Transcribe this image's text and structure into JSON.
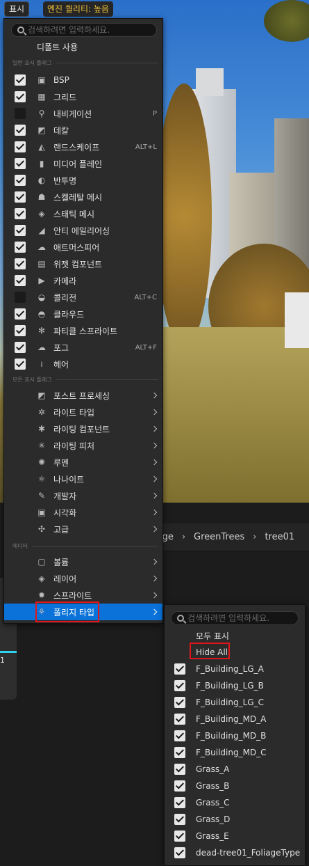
{
  "toolbar": {
    "show_label": "표시",
    "quality_label": "엔진 퀄리티: 높음"
  },
  "breadcrumb": [
    "lage",
    "GreenTrees",
    "tree01"
  ],
  "thumb_label": "1",
  "menu": {
    "search_placeholder": "검색하려면 입력하세요.",
    "default_label": "디폴트 사용",
    "section_common": "일반 표시 플래그",
    "section_all": "모든 표시 플래그",
    "section_editor": "에디터",
    "common_flags": [
      {
        "label": "BSP",
        "checked": true,
        "icon": "cube-icon",
        "shortcut": ""
      },
      {
        "label": "그리드",
        "checked": true,
        "icon": "grid-icon",
        "shortcut": ""
      },
      {
        "label": "내비게이션",
        "checked": false,
        "icon": "map-pin-icon",
        "shortcut": "P"
      },
      {
        "label": "데칼",
        "checked": true,
        "icon": "decal-icon",
        "shortcut": ""
      },
      {
        "label": "랜드스케이프",
        "checked": true,
        "icon": "landscape-icon",
        "shortcut": "ALT+L"
      },
      {
        "label": "미디어 플레인",
        "checked": true,
        "icon": "media-plane-icon",
        "shortcut": ""
      },
      {
        "label": "반투명",
        "checked": true,
        "icon": "translucency-icon",
        "shortcut": ""
      },
      {
        "label": "스켈레탈 메시",
        "checked": true,
        "icon": "skeletal-mesh-icon",
        "shortcut": ""
      },
      {
        "label": "스태틱 메시",
        "checked": true,
        "icon": "static-mesh-icon",
        "shortcut": ""
      },
      {
        "label": "안티 에일리어싱",
        "checked": true,
        "icon": "anti-aliasing-icon",
        "shortcut": ""
      },
      {
        "label": "애트머스피어",
        "checked": true,
        "icon": "atmosphere-icon",
        "shortcut": ""
      },
      {
        "label": "위젯 컴포넌트",
        "checked": true,
        "icon": "widget-icon",
        "shortcut": ""
      },
      {
        "label": "카메라",
        "checked": true,
        "icon": "camera-icon",
        "shortcut": ""
      },
      {
        "label": "콜리전",
        "checked": false,
        "icon": "collision-icon",
        "shortcut": "ALT+C"
      },
      {
        "label": "클라우드",
        "checked": true,
        "icon": "cloud-icon",
        "shortcut": ""
      },
      {
        "label": "파티클 스프라이트",
        "checked": true,
        "icon": "particle-icon",
        "shortcut": ""
      },
      {
        "label": "포그",
        "checked": true,
        "icon": "fog-icon",
        "shortcut": "ALT+F"
      },
      {
        "label": "헤어",
        "checked": true,
        "icon": "hair-icon",
        "shortcut": ""
      }
    ],
    "all_flags": [
      {
        "label": "포스트 프로세싱",
        "icon": "post-process-icon"
      },
      {
        "label": "라이트 타입",
        "icon": "light-type-icon"
      },
      {
        "label": "라이팅 컴포넌트",
        "icon": "lighting-component-icon"
      },
      {
        "label": "라이팅 피처",
        "icon": "lighting-feature-icon"
      },
      {
        "label": "루멘",
        "icon": "lumen-icon"
      },
      {
        "label": "나나이트",
        "icon": "nanite-icon"
      },
      {
        "label": "개발자",
        "icon": "developer-icon"
      },
      {
        "label": "시각화",
        "icon": "visualize-icon"
      },
      {
        "label": "고급",
        "icon": "advanced-icon"
      }
    ],
    "editor_flags": [
      {
        "label": "볼륨",
        "icon": "volume-icon"
      },
      {
        "label": "레이어",
        "icon": "layers-icon"
      },
      {
        "label": "스프라이트",
        "icon": "sprite-icon"
      },
      {
        "label": "폴리지 타입",
        "icon": "foliage-icon"
      }
    ]
  },
  "submenu": {
    "search_placeholder": "검색하려면 입력하세요.",
    "show_all": "모두 표시",
    "hide_all": "Hide All",
    "items": [
      {
        "label": "F_Building_LG_A",
        "checked": true
      },
      {
        "label": "F_Building_LG_B",
        "checked": true
      },
      {
        "label": "F_Building_LG_C",
        "checked": true
      },
      {
        "label": "F_Building_MD_A",
        "checked": true
      },
      {
        "label": "F_Building_MD_B",
        "checked": true
      },
      {
        "label": "F_Building_MD_C",
        "checked": true
      },
      {
        "label": "Grass_A",
        "checked": true
      },
      {
        "label": "Grass_B",
        "checked": true
      },
      {
        "label": "Grass_C",
        "checked": true
      },
      {
        "label": "Grass_D",
        "checked": true
      },
      {
        "label": "Grass_E",
        "checked": true
      },
      {
        "label": "dead-tree01_FoliageType",
        "checked": true
      }
    ]
  },
  "colors": {
    "accent": "#0a72d8",
    "highlight": "#e0161b",
    "quality": "#f0c23a"
  }
}
